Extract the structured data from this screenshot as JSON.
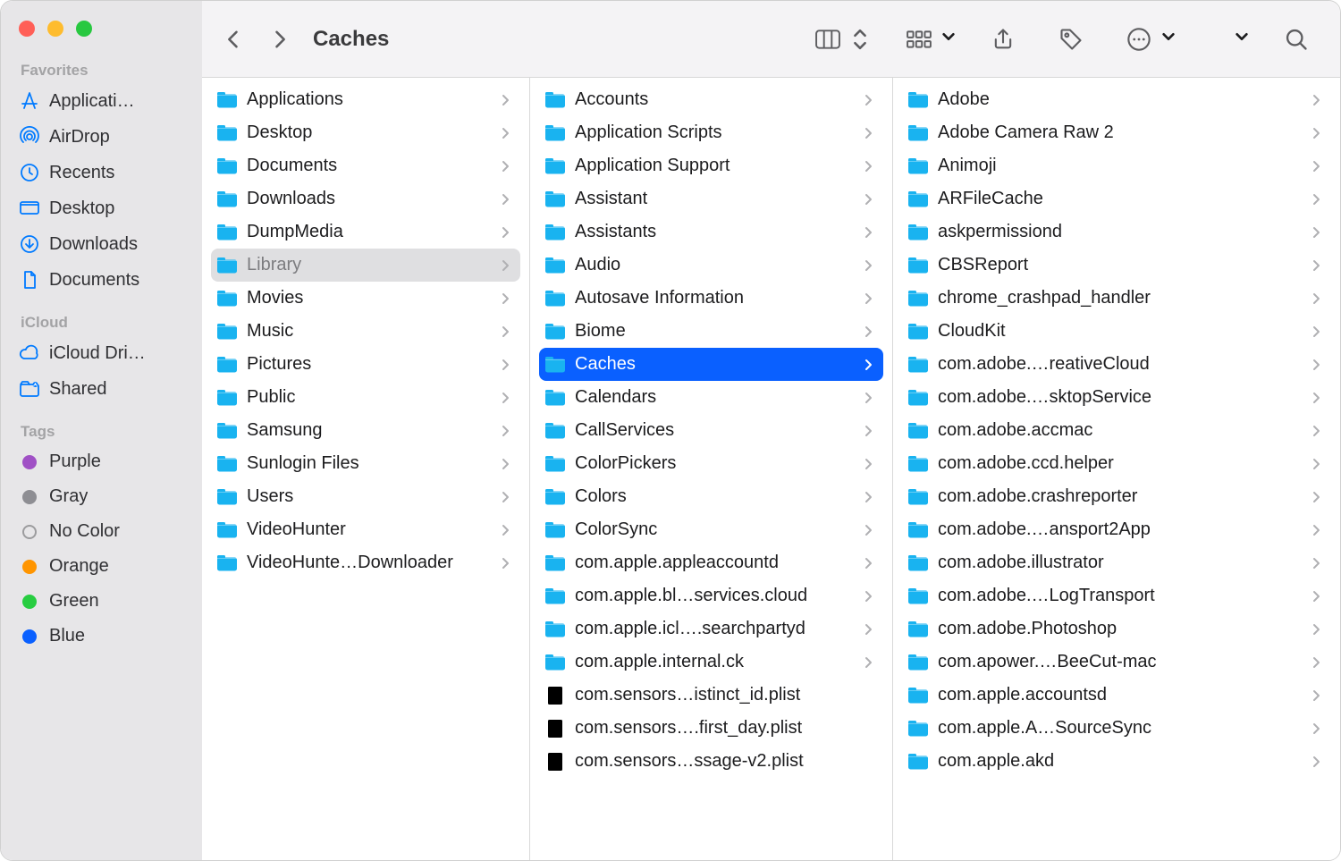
{
  "title": "Caches",
  "sidebar": {
    "sections": [
      {
        "title": "Favorites",
        "items": [
          {
            "icon": "app-store",
            "label": "Applicati…"
          },
          {
            "icon": "airdrop",
            "label": "AirDrop"
          },
          {
            "icon": "clock",
            "label": "Recents"
          },
          {
            "icon": "desktop",
            "label": "Desktop"
          },
          {
            "icon": "download",
            "label": "Downloads"
          },
          {
            "icon": "document",
            "label": "Documents"
          }
        ]
      },
      {
        "title": "iCloud",
        "items": [
          {
            "icon": "cloud",
            "label": "iCloud Dri…"
          },
          {
            "icon": "shared",
            "label": "Shared"
          }
        ]
      },
      {
        "title": "Tags",
        "items": [
          {
            "color": "purple",
            "label": "Purple"
          },
          {
            "color": "gray",
            "label": "Gray"
          },
          {
            "color": "outline",
            "label": "No Color"
          },
          {
            "color": "orange",
            "label": "Orange"
          },
          {
            "color": "green",
            "label": "Green"
          },
          {
            "color": "blue",
            "label": "Blue"
          }
        ]
      }
    ]
  },
  "columns": [
    {
      "items": [
        {
          "type": "folder",
          "name": "Applications"
        },
        {
          "type": "folder",
          "name": "Desktop"
        },
        {
          "type": "folder",
          "name": "Documents"
        },
        {
          "type": "folder",
          "name": "Downloads"
        },
        {
          "type": "folder",
          "name": "DumpMedia"
        },
        {
          "type": "folder",
          "name": "Library",
          "open": true
        },
        {
          "type": "folder",
          "name": "Movies"
        },
        {
          "type": "folder",
          "name": "Music"
        },
        {
          "type": "folder",
          "name": "Pictures"
        },
        {
          "type": "folder",
          "name": "Public"
        },
        {
          "type": "folder",
          "name": "Samsung"
        },
        {
          "type": "folder",
          "name": "Sunlogin Files"
        },
        {
          "type": "folder",
          "name": "Users"
        },
        {
          "type": "folder",
          "name": "VideoHunter"
        },
        {
          "type": "folder",
          "name": "VideoHunte…Downloader"
        }
      ]
    },
    {
      "items": [
        {
          "type": "folder",
          "name": "Accounts"
        },
        {
          "type": "folder",
          "name": "Application Scripts"
        },
        {
          "type": "folder",
          "name": "Application Support"
        },
        {
          "type": "folder",
          "name": "Assistant"
        },
        {
          "type": "folder",
          "name": "Assistants"
        },
        {
          "type": "folder",
          "name": "Audio"
        },
        {
          "type": "folder",
          "name": "Autosave Information"
        },
        {
          "type": "folder",
          "name": "Biome"
        },
        {
          "type": "folder",
          "name": "Caches",
          "selected": true
        },
        {
          "type": "folder",
          "name": "Calendars"
        },
        {
          "type": "folder",
          "name": "CallServices"
        },
        {
          "type": "folder",
          "name": "ColorPickers"
        },
        {
          "type": "folder",
          "name": "Colors"
        },
        {
          "type": "folder",
          "name": "ColorSync"
        },
        {
          "type": "folder",
          "name": "com.apple.appleaccountd"
        },
        {
          "type": "folder",
          "name": "com.apple.bl…services.cloud"
        },
        {
          "type": "folder",
          "name": "com.apple.icl….searchpartyd"
        },
        {
          "type": "folder",
          "name": "com.apple.internal.ck"
        },
        {
          "type": "file",
          "name": "com.sensors…istinct_id.plist"
        },
        {
          "type": "file",
          "name": "com.sensors….first_day.plist"
        },
        {
          "type": "file",
          "name": "com.sensors…ssage-v2.plist"
        }
      ]
    },
    {
      "items": [
        {
          "type": "folder",
          "name": "Adobe"
        },
        {
          "type": "folder",
          "name": "Adobe Camera Raw 2"
        },
        {
          "type": "folder",
          "name": "Animoji"
        },
        {
          "type": "folder",
          "name": "ARFileCache"
        },
        {
          "type": "folder",
          "name": "askpermissiond"
        },
        {
          "type": "folder",
          "name": "CBSReport"
        },
        {
          "type": "folder",
          "name": "chrome_crashpad_handler"
        },
        {
          "type": "folder",
          "name": "CloudKit"
        },
        {
          "type": "folder",
          "name": "com.adobe.…reativeCloud"
        },
        {
          "type": "folder",
          "name": "com.adobe.…sktopService"
        },
        {
          "type": "folder",
          "name": "com.adobe.accmac"
        },
        {
          "type": "folder",
          "name": "com.adobe.ccd.helper"
        },
        {
          "type": "folder",
          "name": "com.adobe.crashreporter"
        },
        {
          "type": "folder",
          "name": "com.adobe.…ansport2App"
        },
        {
          "type": "folder",
          "name": "com.adobe.illustrator"
        },
        {
          "type": "folder",
          "name": "com.adobe.…LogTransport"
        },
        {
          "type": "folder",
          "name": "com.adobe.Photoshop"
        },
        {
          "type": "folder",
          "name": "com.apower.…BeeCut-mac"
        },
        {
          "type": "folder",
          "name": "com.apple.accountsd"
        },
        {
          "type": "folder",
          "name": "com.apple.A…SourceSync"
        },
        {
          "type": "folder",
          "name": "com.apple.akd"
        }
      ]
    }
  ]
}
